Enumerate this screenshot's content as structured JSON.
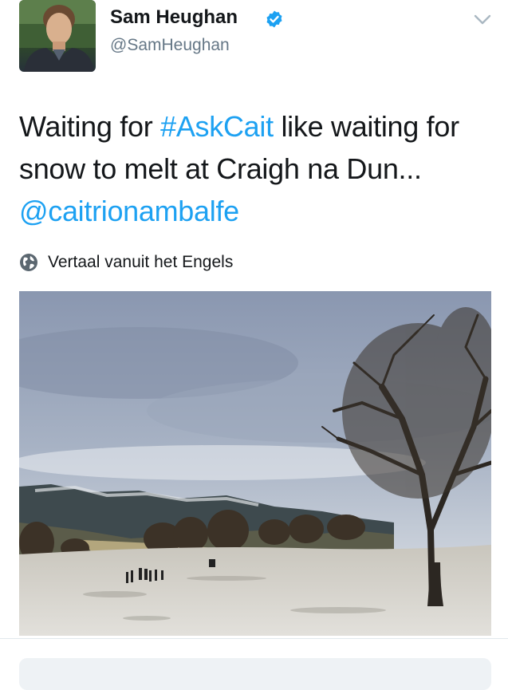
{
  "tweet": {
    "author_name": "Sam Heughan",
    "author_handle": "@SamHeughan",
    "text_before": "Waiting for ",
    "hashtag": "#AskCait",
    "text_after": " like waiting for snow to melt at Craigh na Dun...",
    "mention": "@caitrionambalfe",
    "translate_label": "Vertaal vanuit het Engels"
  },
  "icons": {
    "verified": "verified-badge-icon",
    "menu": "chevron-down-icon",
    "translate": "globe-icon"
  },
  "colors": {
    "link": "#1da1f2",
    "secondary_text": "#657786",
    "divider": "#e1e8ed"
  }
}
